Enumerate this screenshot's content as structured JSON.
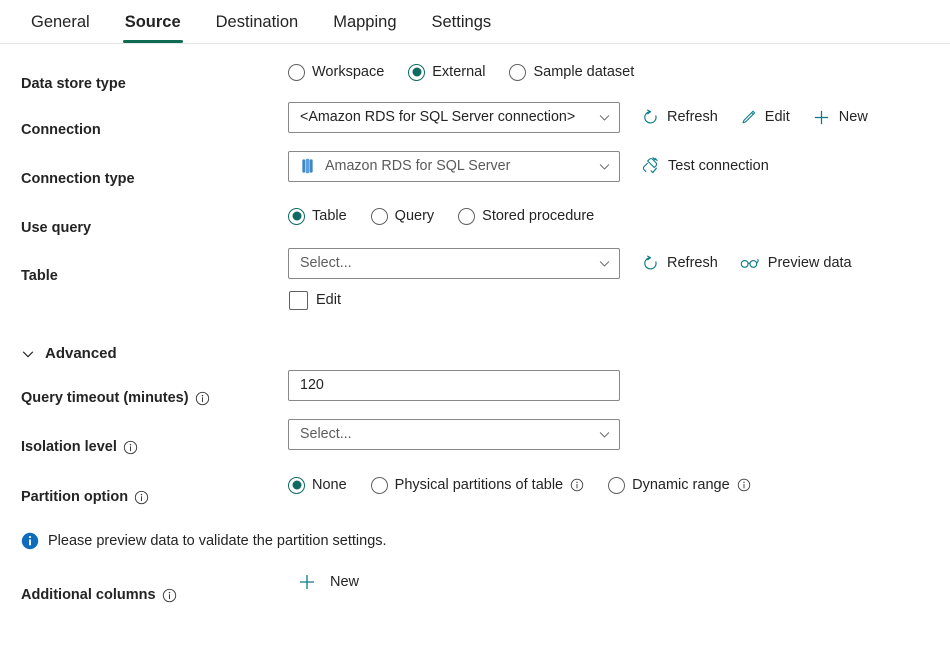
{
  "tabs": [
    {
      "label": "General",
      "active": false
    },
    {
      "label": "Source",
      "active": true
    },
    {
      "label": "Destination",
      "active": false
    },
    {
      "label": "Mapping",
      "active": false
    },
    {
      "label": "Settings",
      "active": false
    }
  ],
  "colors": {
    "accent_green": "#0f6b52",
    "radio_selected": "#0f6b62",
    "action_icon_teal": "#0a7b86",
    "info_blue": "#0f6cbd",
    "aws_icon_blue": "#4a90d9",
    "border_gray": "#8a8886"
  },
  "data_store_type": {
    "label": "Data store type",
    "options": [
      {
        "label": "Workspace",
        "selected": false
      },
      {
        "label": "External",
        "selected": true
      },
      {
        "label": "Sample dataset",
        "selected": false
      }
    ]
  },
  "connection": {
    "label": "Connection",
    "value": "<Amazon RDS for SQL Server connection>",
    "actions": [
      {
        "label": "Refresh",
        "icon": "refresh-icon"
      },
      {
        "label": "Edit",
        "icon": "pencil-icon"
      },
      {
        "label": "New",
        "icon": "plus-icon"
      }
    ]
  },
  "connection_type": {
    "label": "Connection type",
    "value": "Amazon RDS for SQL Server",
    "icon": "amazon-rds-icon",
    "action": {
      "label": "Test connection",
      "icon": "plug-check-icon"
    }
  },
  "use_query": {
    "label": "Use query",
    "options": [
      {
        "label": "Table",
        "selected": true
      },
      {
        "label": "Query",
        "selected": false
      },
      {
        "label": "Stored procedure",
        "selected": false
      }
    ]
  },
  "table": {
    "label": "Table",
    "placeholder": "Select...",
    "value": "",
    "actions": [
      {
        "label": "Refresh",
        "icon": "refresh-icon"
      },
      {
        "label": "Preview data",
        "icon": "glasses-icon"
      }
    ],
    "edit_checkbox": {
      "label": "Edit",
      "checked": false
    }
  },
  "advanced": {
    "title": "Advanced",
    "expanded": true,
    "chevron": "chevron-down-icon"
  },
  "query_timeout": {
    "label": "Query timeout (minutes)",
    "value": "120",
    "has_info": true
  },
  "isolation_level": {
    "label": "Isolation level",
    "placeholder": "Select...",
    "value": "",
    "has_info": true
  },
  "partition_option": {
    "label": "Partition option",
    "has_info": true,
    "options": [
      {
        "label": "None",
        "selected": true,
        "has_info": false
      },
      {
        "label": "Physical partitions of table",
        "selected": false,
        "has_info": true
      },
      {
        "label": "Dynamic range",
        "selected": false,
        "has_info": true
      }
    ]
  },
  "info_message": {
    "text": "Please preview data to validate the partition settings.",
    "icon": "info-filled-icon"
  },
  "additional_columns": {
    "label": "Additional columns",
    "has_info": true,
    "action": {
      "label": "New",
      "icon": "plus-icon"
    }
  }
}
